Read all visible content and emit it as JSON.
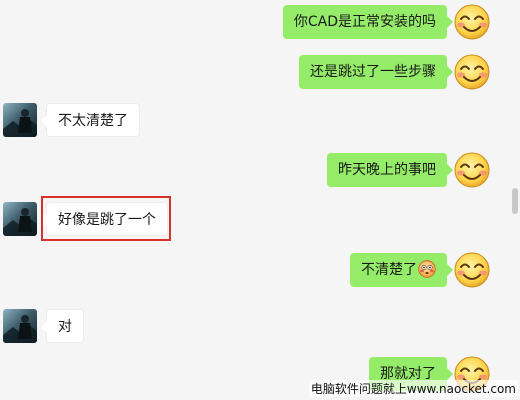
{
  "chat": {
    "messages": [
      {
        "side": "right",
        "text": "你CAD是正常安装的吗"
      },
      {
        "side": "right",
        "text": "还是跳过了一些步骤"
      },
      {
        "side": "left",
        "text": "不太清楚了"
      },
      {
        "side": "right",
        "text": "昨天晚上的事吧"
      },
      {
        "side": "left",
        "text": "好像是跳了一个"
      },
      {
        "side": "right",
        "text": "不清楚了"
      },
      {
        "side": "left",
        "text": "对"
      },
      {
        "side": "right",
        "text": "那就对了"
      }
    ],
    "highlighted_message_index": 4
  },
  "icons": {
    "self_avatar": "smiley-face-icon",
    "contact_avatar": "contact-avatar-photo",
    "inline_emoji": "flushed-face-emoji"
  },
  "colors": {
    "background": "#f5f5f5",
    "self_bubble": "#95ec69",
    "contact_bubble": "#ffffff",
    "highlight_box": "#d8312b"
  },
  "watermark": {
    "text": "电脑软件问题就上www.naocket.com"
  }
}
